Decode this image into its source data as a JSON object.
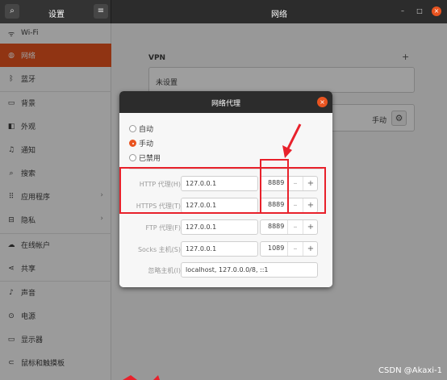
{
  "header": {
    "left_title": "设置",
    "title": "网络",
    "search_icon": "search-icon",
    "menu_icon": "hamburger-menu-icon",
    "minimize": "–",
    "maximize": "□",
    "close": "×"
  },
  "sidebar": {
    "items": [
      {
        "label": "Wi-Fi",
        "icon": "wifi-icon",
        "glyph": "ᯤ"
      },
      {
        "label": "网络",
        "icon": "network-icon",
        "glyph": "◍",
        "active": true
      },
      {
        "label": "蓝牙",
        "icon": "bluetooth-icon",
        "glyph": "ᛒ"
      },
      {
        "label": "背景",
        "icon": "background-icon",
        "glyph": "▭"
      },
      {
        "label": "外观",
        "icon": "appearance-icon",
        "glyph": "◧"
      },
      {
        "label": "通知",
        "icon": "notification-icon",
        "glyph": "♫"
      },
      {
        "label": "搜索",
        "icon": "search-icon",
        "glyph": "⌕"
      },
      {
        "label": "应用程序",
        "icon": "applications-icon",
        "glyph": "⠿",
        "arrow": "›"
      },
      {
        "label": "隐私",
        "icon": "privacy-icon",
        "glyph": "⊟",
        "arrow": "›"
      },
      {
        "label": "在线帐户",
        "icon": "online-accounts-icon",
        "glyph": "☁"
      },
      {
        "label": "共享",
        "icon": "share-icon",
        "glyph": "⋖"
      },
      {
        "label": "声音",
        "icon": "sound-icon",
        "glyph": "♪"
      },
      {
        "label": "电源",
        "icon": "power-icon",
        "glyph": "⊙"
      },
      {
        "label": "显示器",
        "icon": "display-icon",
        "glyph": "▭"
      },
      {
        "label": "鼠标和触摸板",
        "icon": "mouse-icon",
        "glyph": "⊂"
      }
    ]
  },
  "main": {
    "vpn_title": "VPN",
    "vpn_add": "+",
    "vpn_status": "未设置",
    "proxy_mode": "手动"
  },
  "dialog": {
    "title": "网络代理",
    "modes": [
      {
        "label": "自动",
        "selected": false
      },
      {
        "label": "手动",
        "selected": true
      },
      {
        "label": "已禁用",
        "selected": false
      }
    ],
    "rows": [
      {
        "label": "HTTP 代理(H)",
        "host": "127.0.0.1",
        "port": "8889"
      },
      {
        "label": "HTTPS 代理(T)",
        "host": "127.0.0.1",
        "port": "8889"
      },
      {
        "label": "FTP 代理(F)",
        "host": "127.0.0.1",
        "port": "8889"
      },
      {
        "label": "Socks 主机(S)",
        "host": "127.0.0.1",
        "port": "1089"
      }
    ],
    "ignore_label": "忽略主机(I)",
    "ignore_value": "localhost, 127.0.0.0/8, ::1",
    "minus": "–",
    "plus": "+"
  },
  "watermark": "CSDN @Akaxi-1",
  "colors": {
    "accent": "#e95420",
    "annotation": "#e8212b",
    "header": "#2c2c2c"
  }
}
